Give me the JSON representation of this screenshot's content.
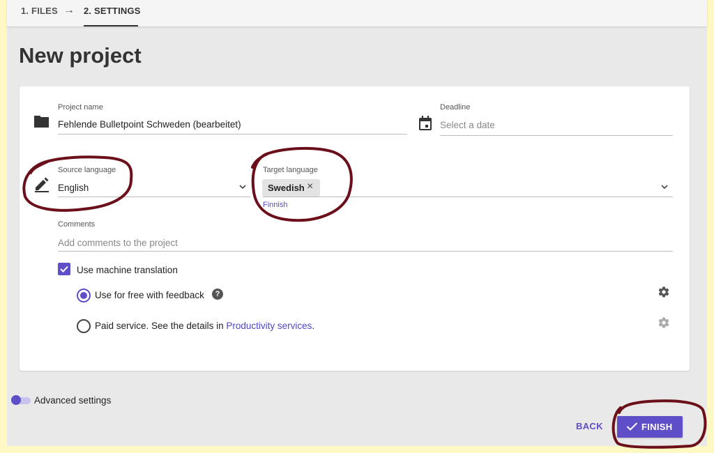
{
  "steps": {
    "step1": "1. FILES",
    "arrow": "→",
    "step2": "2. SETTINGS"
  },
  "page_title": "New project",
  "form": {
    "project_name": {
      "label": "Project name",
      "value": "Fehlende Bulletpoint Schweden (bearbeitet)"
    },
    "deadline": {
      "label": "Deadline",
      "placeholder": "Select a date"
    },
    "source_language": {
      "label": "Source language",
      "value": "English"
    },
    "target_language": {
      "label": "Target language",
      "chip": "Swedish",
      "suggestion": "Finnish"
    },
    "comments": {
      "label": "Comments",
      "placeholder": "Add comments to the project"
    },
    "machine_translation": {
      "label": "Use machine translation",
      "checked": true,
      "option_free": "Use for free with feedback",
      "help": "?",
      "option_paid_prefix": "Paid service. See the details in ",
      "option_paid_link": "Productivity services",
      "option_paid_suffix": ".",
      "selected": "free"
    }
  },
  "advanced_settings": "Advanced settings",
  "actions": {
    "back": "BACK",
    "finish": "FINISH"
  },
  "icons": {
    "folder": "folder-icon",
    "calendar": "calendar-icon",
    "pencil": "pencil-icon",
    "gear": "gear-icon",
    "check": "check-icon"
  },
  "colors": {
    "accent": "#5e4fc9",
    "link": "#4f46c8",
    "annotation": "#6b0f1a",
    "outer_background": "#fdf8c4"
  }
}
